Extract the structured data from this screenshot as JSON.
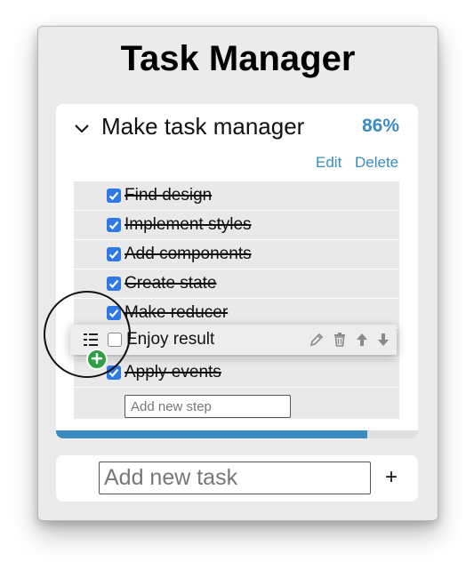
{
  "app": {
    "title": "Task Manager"
  },
  "task": {
    "name": "Make task manager",
    "percent_label": "86%",
    "progress": 0.86,
    "edit_label": "Edit",
    "delete_label": "Delete",
    "expanded": true
  },
  "steps": [
    {
      "label": "Find design",
      "done": true
    },
    {
      "label": "Implement styles",
      "done": true
    },
    {
      "label": "Add components",
      "done": true
    },
    {
      "label": "Create state",
      "done": true
    },
    {
      "label": "Make reducer",
      "done": true
    },
    {
      "label": "Apply events",
      "done": true
    }
  ],
  "dragged_step": {
    "label": "Enjoy result",
    "done": false,
    "icons": [
      "drag-handle-icon",
      "pencil-icon",
      "trash-icon",
      "arrow-up-icon",
      "arrow-down-icon"
    ]
  },
  "new_step": {
    "placeholder": "Add new step",
    "value": ""
  },
  "new_task": {
    "placeholder": "Add new task",
    "value": "",
    "add_label": "+"
  },
  "colors": {
    "accent": "#3a8bbf",
    "checkbox": "#2f79e6",
    "copy_badge": "#2ea043",
    "window_bg": "#ebebeb",
    "steps_bg": "#e9e9e9"
  }
}
